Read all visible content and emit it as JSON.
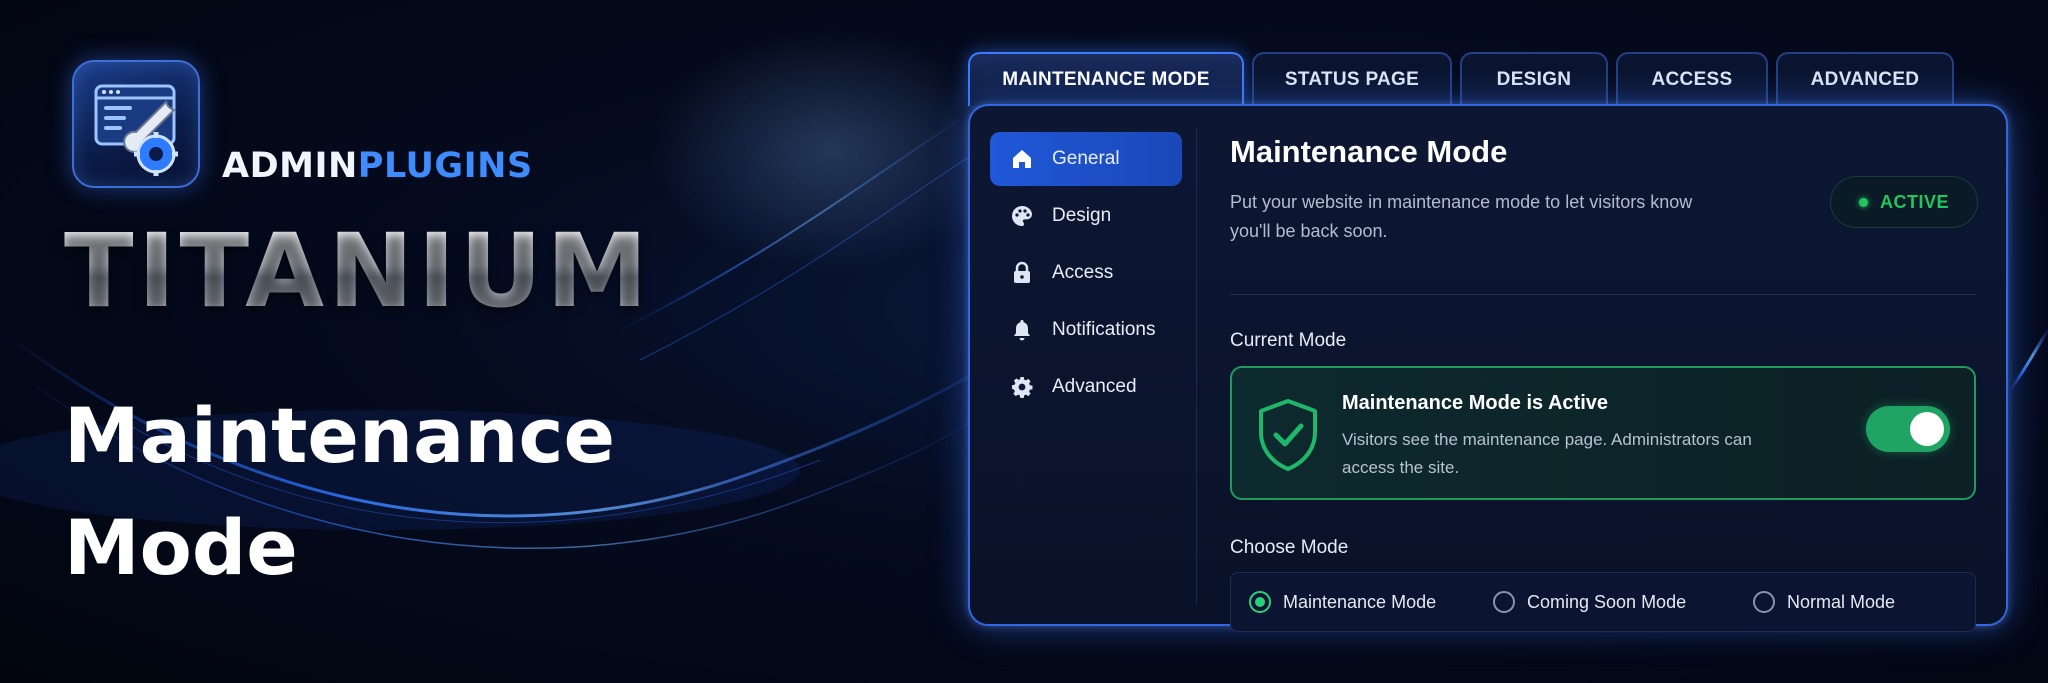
{
  "brand": {
    "name_part1": "ADMIN",
    "name_part2": "PLUGINS",
    "product": "TITANIUM",
    "subtitle_line1": "Maintenance",
    "subtitle_line2": "Mode",
    "logo_icon": "browser-wrench-gear-icon"
  },
  "tabs": [
    {
      "label": "MAINTENANCE MODE",
      "active": true
    },
    {
      "label": "STATUS PAGE",
      "active": false
    },
    {
      "label": "DESIGN",
      "active": false
    },
    {
      "label": "ACCESS",
      "active": false
    },
    {
      "label": "ADVANCED",
      "active": false
    }
  ],
  "sidebar": {
    "items": [
      {
        "label": "General",
        "icon": "home-icon",
        "active": true
      },
      {
        "label": "Design",
        "icon": "palette-icon",
        "active": false
      },
      {
        "label": "Access",
        "icon": "lock-icon",
        "active": false
      },
      {
        "label": "Notifications",
        "icon": "bell-icon",
        "active": false
      },
      {
        "label": "Advanced",
        "icon": "gear-icon",
        "active": false
      }
    ]
  },
  "main": {
    "title": "Maintenance Mode",
    "description": "Put your website in maintenance mode to let visitors know you'll be back soon.",
    "status": "ACTIVE",
    "current_mode_label": "Current Mode",
    "card": {
      "title": "Maintenance Mode is Active",
      "description": "Visitors see the maintenance page. Administrators can access the site.",
      "icon": "shield-check-icon",
      "toggle_on": true
    },
    "choose_mode_label": "Choose Mode",
    "modes": [
      {
        "label": "Maintenance Mode",
        "selected": true
      },
      {
        "label": "Coming Soon Mode",
        "selected": false
      },
      {
        "label": "Normal Mode",
        "selected": false
      }
    ]
  },
  "colors": {
    "accent_blue": "#3f8cff",
    "active_green": "#22c55e",
    "panel_border": "#3367e0",
    "background": "#050b1f"
  }
}
